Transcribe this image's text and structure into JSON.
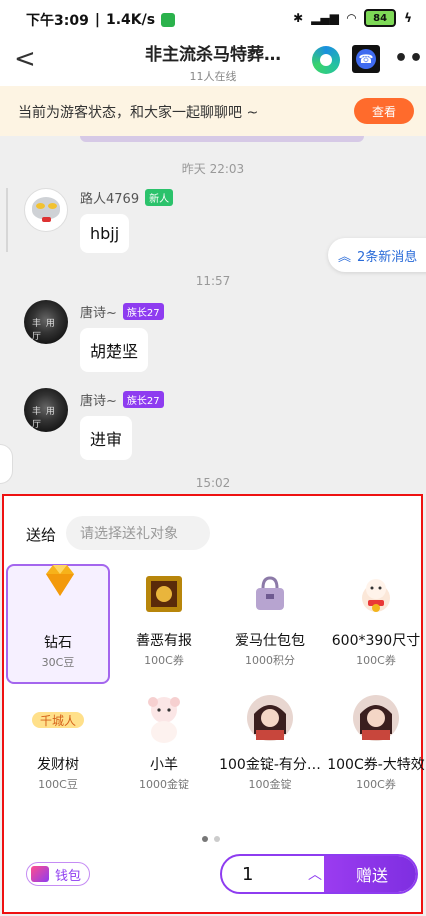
{
  "status_bar": {
    "time": "下午3:09",
    "speed": "1.4K/s",
    "battery": "84"
  },
  "header": {
    "back": "<",
    "title": "非主流杀马特葬…",
    "subtitle": "11人在线",
    "more": "•••"
  },
  "banner": {
    "text": "当前为游客状态，和大家一起聊聊吧 ~",
    "button": "查看"
  },
  "chat": {
    "times": [
      "昨天 22:03",
      "11:57",
      "15:02"
    ],
    "messages": [
      {
        "name": "路人4769",
        "tag": "新人",
        "text": "hbjj"
      },
      {
        "name": "唐诗~",
        "tag": "族长27",
        "text": "胡楚坚"
      },
      {
        "name": "唐诗~",
        "tag": "族长27",
        "text": "进审"
      }
    ],
    "new_messages": "2条新消息"
  },
  "gift_panel": {
    "send_to": "送给",
    "target_placeholder": "请选择送礼对象",
    "gifts": [
      {
        "name": "钻石",
        "price": "30C豆",
        "icon": "diamond-icon",
        "selected": true
      },
      {
        "name": "善恶有报",
        "price": "100C券",
        "icon": "golden-frame-icon"
      },
      {
        "name": "爱马仕包包",
        "price": "1000积分",
        "icon": "handbag-icon"
      },
      {
        "name": "600*390尺寸",
        "price": "100C券",
        "icon": "lucky-cat-icon"
      },
      {
        "name": "发财树",
        "price": "100C豆",
        "icon": "fortune-text-icon"
      },
      {
        "name": "小羊",
        "price": "1000金锭",
        "icon": "lamb-icon"
      },
      {
        "name": "100金锭-有分…",
        "price": "100金锭",
        "icon": "portrait-icon"
      },
      {
        "name": "100C券-大特效",
        "price": "100C券",
        "icon": "portrait-icon"
      }
    ],
    "wallet": "钱包",
    "quantity": "1",
    "send_button": "赠送"
  }
}
